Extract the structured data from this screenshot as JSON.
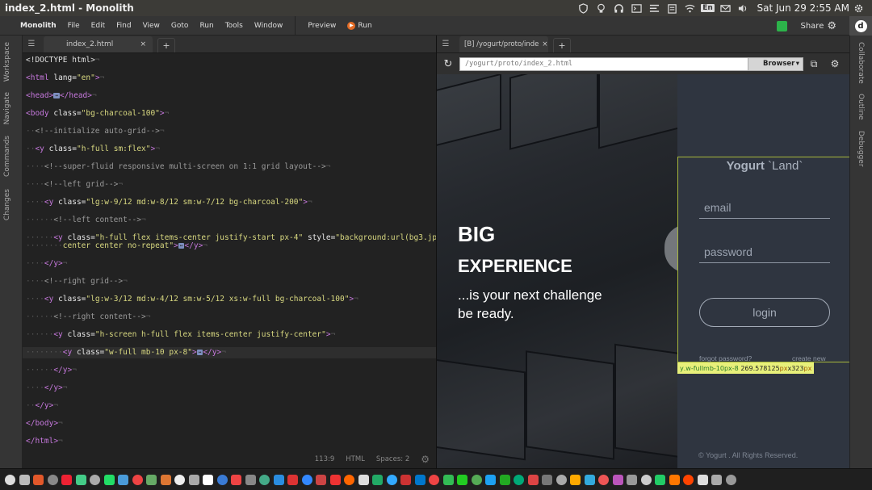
{
  "window": {
    "title": "index_2.html - Monolith"
  },
  "system_tray": {
    "icons": [
      "shield-icon",
      "lightbulb-icon",
      "headphones-icon",
      "terminal-icon",
      "list-icon",
      "clipboard-icon",
      "wifi-icon"
    ],
    "lang": "En",
    "clock": "Sat Jun 29  2:55 AM"
  },
  "menu": {
    "brand": "Monolith",
    "items": [
      "File",
      "Edit",
      "Find",
      "View",
      "Goto",
      "Run",
      "Tools",
      "Window"
    ],
    "preview": "Preview",
    "run": "Run",
    "share": "Share",
    "d_letter": "d"
  },
  "left_sidebar": [
    "Workspace",
    "Navigate",
    "Commands",
    "Changes"
  ],
  "right_sidebar": [
    "Collaborate",
    "Outline",
    "Debugger"
  ],
  "editor": {
    "tab": "index_2.html",
    "close": "×",
    "plus": "+",
    "status": {
      "position": "113:9",
      "mode": "HTML",
      "spaces": "Spaces: 2"
    }
  },
  "preview": {
    "tab": "[B] /yogurt/proto/inde",
    "close": "×",
    "plus": "+",
    "url": "/yogurt/proto/index_2.html",
    "browser_label": "Browser",
    "hero": {
      "big": "BIG",
      "experience": "EXPERIENCE",
      "tagline_1": "...is your next challenge",
      "tagline_2": "be ready."
    },
    "login": {
      "logo_a": "Yogurt",
      "logo_b": " `Land`",
      "email_placeholder": "email",
      "password_placeholder": "password",
      "button": "login",
      "forgot": "forgot password?",
      "create": "create new"
    },
    "tooltip": {
      "selector": "y",
      "classes": ".w-fullmb-10px-8",
      "width": "269.578125",
      "unit1": "px",
      "times": " x ",
      "height": "323",
      "unit2": "px"
    },
    "copyright": "© Yogurt . All Rights Reserved."
  },
  "colors": {
    "accent_green": "#2cb34a",
    "run_orange": "#e36b25",
    "selection_outline": "#a8b83c",
    "tooltip_bg": "#e8f07a"
  }
}
